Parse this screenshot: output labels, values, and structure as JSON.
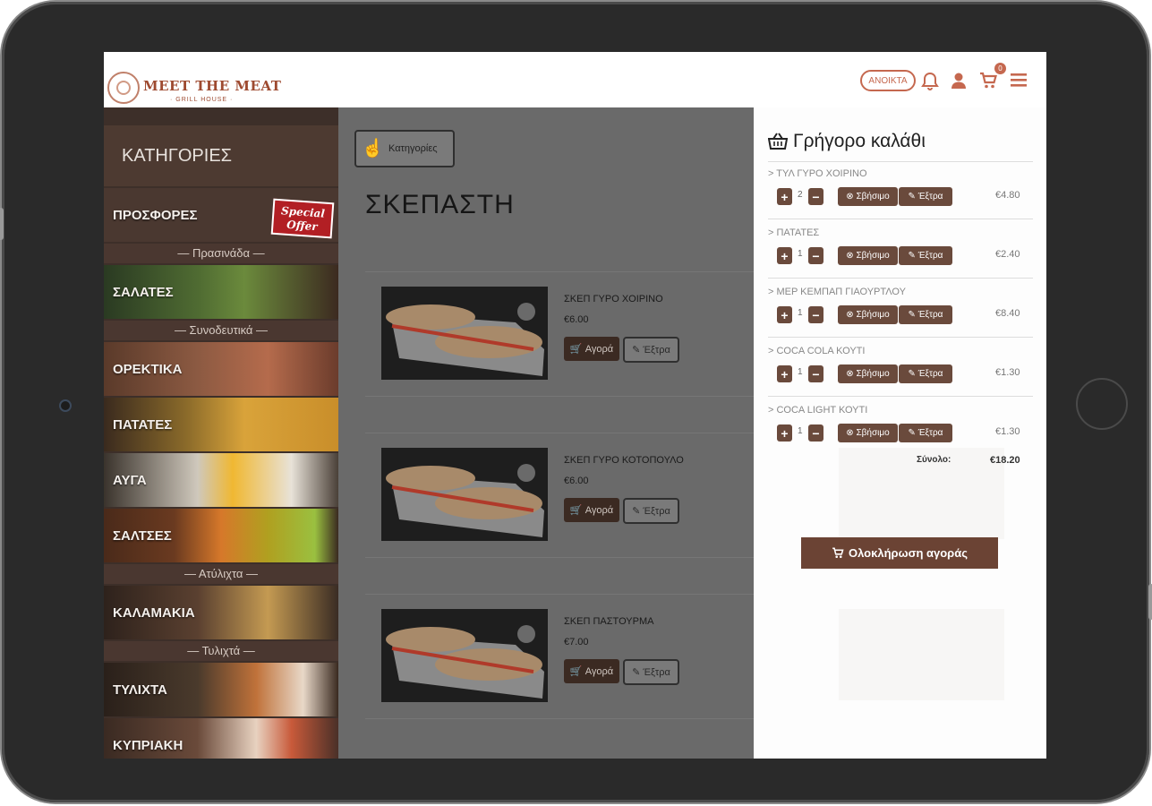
{
  "header": {
    "brand": "MEET THE MEAT",
    "brand_sub": "· GRILL HOUSE ·",
    "status": "ΑΝΟΙΚΤΑ",
    "cart_count": "0",
    "icons": [
      "bell-icon",
      "user-icon",
      "cart-icon",
      "menu-icon"
    ]
  },
  "sidebar": {
    "title": "ΚΑΤΗΓΟΡΙΕΣ",
    "offers": "ΠΡΟΣΦΟΡΕΣ",
    "special_tag": "Special Offer",
    "groups": [
      {
        "divider": "— Πρασινάδα —",
        "items": [
          "ΣΑΛΑΤΕΣ"
        ]
      },
      {
        "divider": "— Συνοδευτικά —",
        "items": [
          "ΟΡΕΚΤΙΚΑ",
          "ΠΑΤΑΤΕΣ",
          "ΑΥΓΑ",
          "ΣΑΛΤΣΕΣ"
        ]
      },
      {
        "divider": "— Ατύλιχτα —",
        "items": [
          "ΚΑΛΑΜΑΚΙΑ"
        ]
      },
      {
        "divider": "— Τυλιχτά —",
        "items": [
          "ΤΥΛΙΧΤΑ",
          "ΚΥΠΡΙΑΚΗ"
        ]
      }
    ]
  },
  "main": {
    "categories_button": "Κατηγορίες",
    "title": "ΣΚΕΠΑΣΤΗ",
    "buy_label": "Αγορά",
    "extra_label": "Έξτρα",
    "products": [
      {
        "name": "ΣΚΕΠ ΓΥΡΟ ΧΟΙΡΙΝΟ",
        "price": "€6.00"
      },
      {
        "name": "ΣΚΕΠ ΓΥΡΟ ΚΟΤΟΠΟΥΛΟ",
        "price": "€6.00"
      },
      {
        "name": "ΣΚΕΠ ΠΑΣΤΟΥΡΜΑ",
        "price": "€7.00"
      }
    ]
  },
  "cart": {
    "title": "Γρήγορο καλάθι",
    "delete_label": "Σβήσιμο",
    "extra_label": "Έξτρα",
    "items": [
      {
        "name": "> ΤΥΛ ΓΥΡΟ ΧΟΙΡΙΝΟ",
        "qty": "2",
        "price": "€4.80"
      },
      {
        "name": "> ΠΑΤΑΤΕΣ",
        "qty": "1",
        "price": "€2.40"
      },
      {
        "name": "> ΜΕΡ ΚΕΜΠΑΠ ΓΙΑΟΥΡΤΛΟΥ",
        "qty": "1",
        "price": "€8.40"
      },
      {
        "name": "> COCA COLA ΚΟΥΤΙ",
        "qty": "1",
        "price": "€1.30"
      },
      {
        "name": "> COCA LIGHT ΚΟΥΤΙ",
        "qty": "1",
        "price": "€1.30"
      }
    ],
    "total_label": "Σύνολο:",
    "total_value": "€18.20",
    "checkout_label": "Ολοκλήρωση αγοράς"
  },
  "colors": {
    "accent": "#c5684f",
    "brown_button": "#6a4a3c",
    "checkout": "#6b4334",
    "sidebar": "#3d2f29"
  }
}
